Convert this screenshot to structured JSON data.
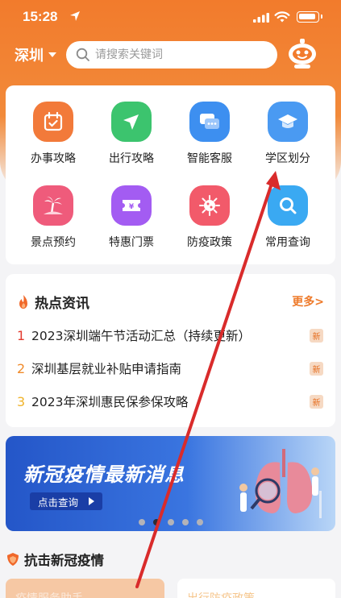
{
  "status_bar": {
    "time": "15:28"
  },
  "header": {
    "city": "深圳",
    "search_placeholder": "请搜索关键词"
  },
  "services": [
    {
      "label": "办事攻略",
      "icon": "calendar-icon",
      "color": "#f27a3a"
    },
    {
      "label": "出行攻略",
      "icon": "send-icon",
      "color": "#3cc46e"
    },
    {
      "label": "智能客服",
      "icon": "chat-icon",
      "color": "#3d8ff0"
    },
    {
      "label": "学区划分",
      "icon": "graduation-cap-icon",
      "color": "#4a9af2"
    },
    {
      "label": "景点预约",
      "icon": "palm-tree-icon",
      "color": "#ef5b7b"
    },
    {
      "label": "特惠门票",
      "icon": "ticket-icon",
      "color": "#a35cf2"
    },
    {
      "label": "防疫政策",
      "icon": "virus-icon",
      "color": "#f25a6a"
    },
    {
      "label": "常用查询",
      "icon": "search-icon",
      "color": "#3aa9f2"
    }
  ],
  "news": {
    "title": "热点资讯",
    "more": "更多>",
    "badge": "新",
    "items": [
      {
        "num": "1",
        "text": "2023深圳端午节活动汇总（持续更新）",
        "num_color": "#e33b2f"
      },
      {
        "num": "2",
        "text": "深圳基层就业补贴申请指南",
        "num_color": "#f08a2a"
      },
      {
        "num": "3",
        "text": "2023年深圳惠民保参保攻略",
        "num_color": "#f0b32a"
      }
    ]
  },
  "banner": {
    "title": "新冠疫情最新消息",
    "button": "点击查询",
    "dots": 5,
    "active_dot": 1
  },
  "section2": {
    "title": "抗击新冠疫情"
  },
  "cards": {
    "left": "疫情服务助手",
    "right": "出行防疫政策"
  }
}
